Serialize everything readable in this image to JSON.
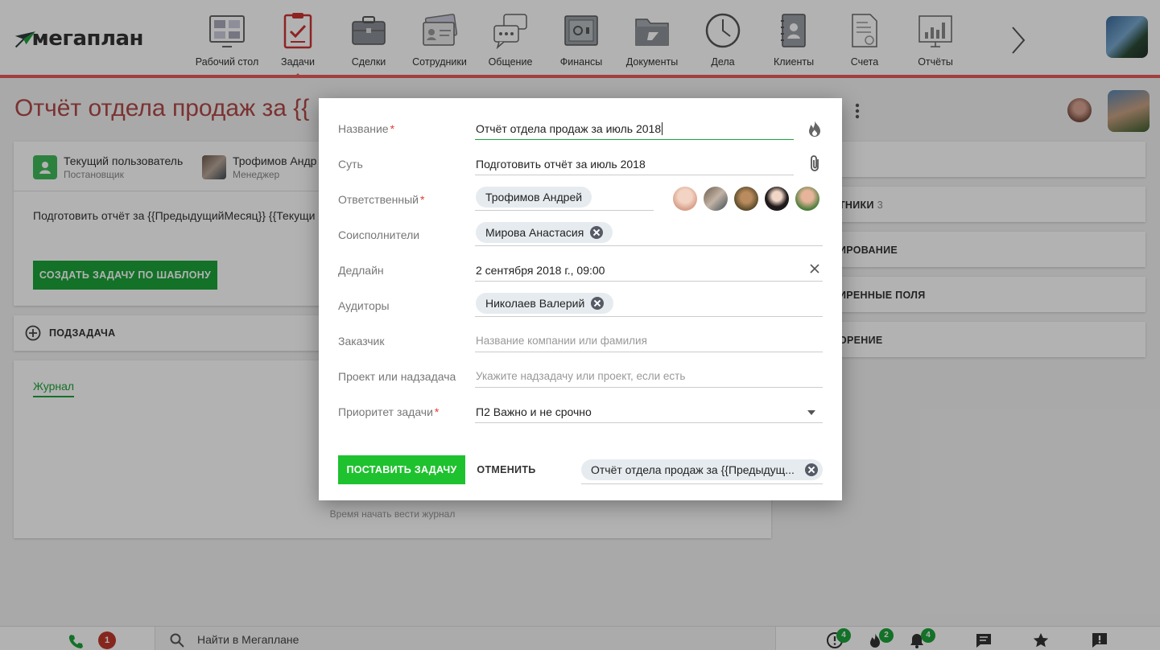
{
  "app": {
    "logo_text": "мегаплан"
  },
  "nav": {
    "items": [
      {
        "label": "Рабочий стол",
        "icon": "dashboard-icon"
      },
      {
        "label": "Задачи",
        "icon": "clipboard-check-icon",
        "active": true
      },
      {
        "label": "Сделки",
        "icon": "briefcase-icon"
      },
      {
        "label": "Сотрудники",
        "icon": "id-cards-icon"
      },
      {
        "label": "Общение",
        "icon": "chat-bubbles-icon"
      },
      {
        "label": "Финансы",
        "icon": "safe-icon"
      },
      {
        "label": "Документы",
        "icon": "folder-icon"
      },
      {
        "label": "Дела",
        "icon": "clock-icon"
      },
      {
        "label": "Клиенты",
        "icon": "contact-book-icon"
      },
      {
        "label": "Счета",
        "icon": "invoice-icon"
      },
      {
        "label": "Отчёты",
        "icon": "bar-chart-board-icon"
      }
    ],
    "accent": "#e85a5a"
  },
  "page": {
    "title": "Отчёт отдела продаж за {{",
    "owner": {
      "name": "Текущий пользователь",
      "role": "Постановщик"
    },
    "manager": {
      "name": "Трофимов Андр",
      "role": "Менеджер"
    },
    "task_text": "Подготовить отчёт за {{ПредыдущийМесяц}} {{Текущи",
    "template_button": "СОЗДАТЬ ЗАДАЧУ ПО ШАБЛОНУ",
    "subtask_label": "ПОДЗАДАЧА",
    "journal_tab": "Журнал",
    "journal_empty": "Время начать вести журнал"
  },
  "side_cards": [
    {
      "label": ""
    },
    {
      "label": "ТНИКИ",
      "count": "3"
    },
    {
      "label": "ИРОВАНИЕ"
    },
    {
      "label": "ИРЕННЫЕ ПОЛЯ"
    },
    {
      "label": "ОРЕНИЕ"
    }
  ],
  "modal": {
    "fields": {
      "name": {
        "label": "Название",
        "value": "Отчёт отдела продаж за июль 2018"
      },
      "essence": {
        "label": "Суть",
        "value": "Подготовить отчёт за июль 2018"
      },
      "responsible": {
        "label": "Ответственный",
        "value": "Трофимов Андрей"
      },
      "coexecutors": {
        "label": "Соисполнители",
        "value": "Мирова Анастасия"
      },
      "deadline": {
        "label": "Дедлайн",
        "value": "2 сентября 2018 г., 09:00"
      },
      "auditors": {
        "label": "Аудиторы",
        "value": "Николаев Валерий"
      },
      "customer": {
        "label": "Заказчик",
        "placeholder": "Название компании или фамилия"
      },
      "project": {
        "label": "Проект или надзадача",
        "placeholder": "Укажите надзадачу или проект, если есть"
      },
      "priority": {
        "label": "Приоритет задачи",
        "value": "П2 Важно и не срочно"
      }
    },
    "submit": "ПОСТАВИТЬ ЗАДАЧУ",
    "cancel": "ОТМЕНИТЬ",
    "template_chip": "Отчёт отдела продаж за {{Предыдущ..."
  },
  "bottombar": {
    "calls_badge": "1",
    "search_placeholder": "Найти в Мегаплане",
    "badges": {
      "overdue": "4",
      "hot": "2",
      "notifications": "4"
    },
    "brand_green": "#1ca33a",
    "badge_red": "#c0392b"
  }
}
